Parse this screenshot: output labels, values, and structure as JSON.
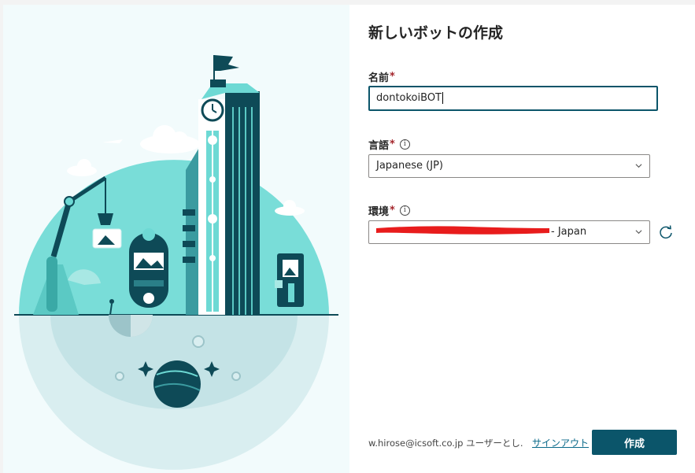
{
  "dialog": {
    "title": "新しいボットの作成",
    "name_field": {
      "label": "名前",
      "required_mark": "*",
      "value": "dontokoiBOT"
    },
    "language_field": {
      "label": "言語",
      "required_mark": "*",
      "info_glyph": "i",
      "value": "Japanese (JP)"
    },
    "environment_field": {
      "label": "環境",
      "required_mark": "*",
      "info_glyph": "i",
      "value_suffix": "- Japan",
      "value_redacted": true
    },
    "footer": {
      "user_text": "w.hirose@icsoft.co.jp ユーザーとし...",
      "signout_label": "サインアウト",
      "create_label": "作成"
    }
  },
  "colors": {
    "accent": "#0b556a",
    "link": "#0b6a8a",
    "required": "#a4262c",
    "illustration_teal": "#6dd9d4",
    "illustration_dark": "#0e4a57",
    "redaction": "#e81c1c"
  },
  "icons": [
    "info-icon",
    "chevron-down-icon",
    "refresh-icon"
  ]
}
